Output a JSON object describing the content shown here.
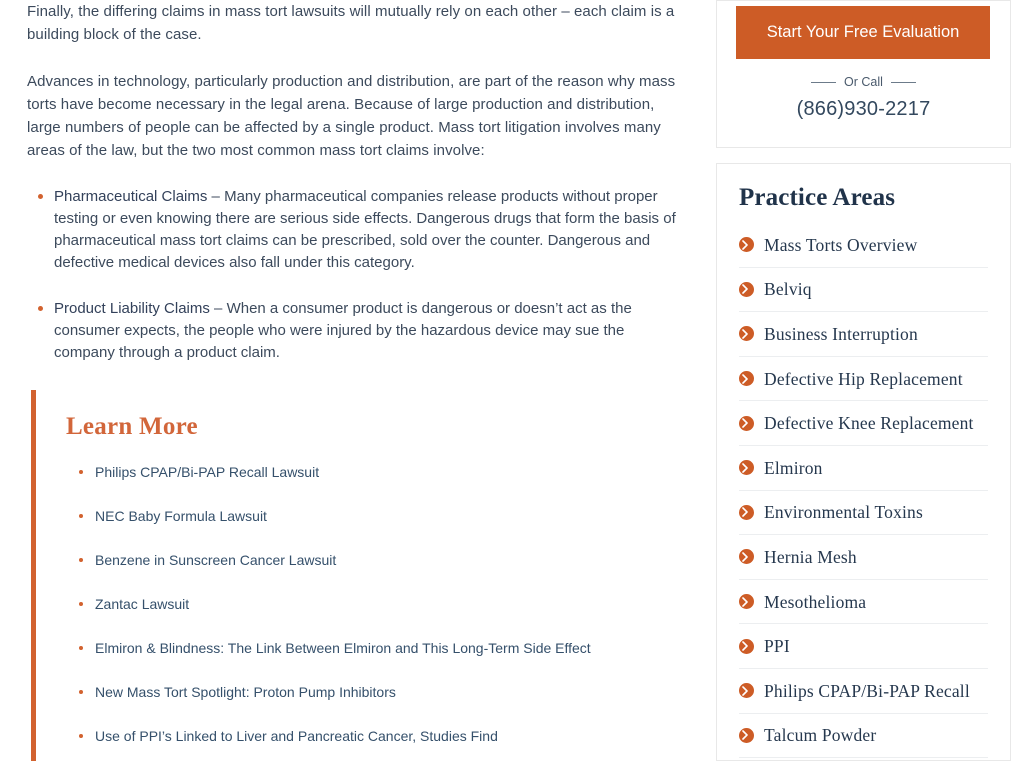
{
  "main": {
    "paragraphs": [
      "Finally, the differing claims in mass tort lawsuits will mutually rely on each other – each claim is a building block of the case.",
      "Advances in technology, particularly production and distribution, are part of the reason why mass torts have become necessary in the legal arena. Because of large production and distribution, large numbers of people can be affected by a single product. Mass tort litigation involves many areas of the law, but the two most common mass tort claims involve:"
    ],
    "claims": [
      {
        "title": "Pharmaceutical Claims",
        "body": " – Many pharmaceutical companies release products without proper testing or even knowing there are serious side effects. Dangerous drugs that form the basis of pharmaceutical mass tort claims can be prescribed, sold over the counter. Dangerous and defective medical devices also fall under this category."
      },
      {
        "title": "Product Liability Claims",
        "body": " – When a consumer product is dangerous or doesn’t act as the consumer expects, the people who were injured by the hazardous device may sue the company through a product claim."
      }
    ]
  },
  "learn_more": {
    "heading": "Learn More",
    "links": [
      "Philips CPAP/Bi-PAP Recall Lawsuit",
      "NEC Baby Formula Lawsuit",
      "Benzene in Sunscreen Cancer Lawsuit",
      "Zantac Lawsuit",
      "Elmiron & Blindness: The Link Between Elmiron and This Long-Term Side Effect",
      "New Mass Tort Spotlight: Proton Pump Inhibitors",
      "Use of PPI’s Linked to Liver and Pancreatic Cancer, Studies Find"
    ]
  },
  "sidebar": {
    "cta": {
      "button_label": "Start Your Free Evaluation",
      "or_call_label": "Or Call",
      "phone": "(866)930-2217"
    },
    "practice_areas": {
      "heading": "Practice Areas",
      "items": [
        "Mass Torts Overview",
        "Belviq",
        "Business Interruption",
        "Defective Hip Replacement",
        "Defective Knee Replacement",
        "Elmiron",
        "Environmental Toxins",
        "Hernia Mesh",
        "Mesothelioma",
        "PPI",
        "Philips CPAP/Bi-PAP Recall",
        "Talcum Powder"
      ],
      "item_icon": "chevron-right-circle-icon"
    }
  },
  "colors": {
    "accent_orange": "#cd5c26",
    "heading_orange": "#d2663a",
    "navy": "#20334a",
    "body_text": "#3c4a5c",
    "link_blue": "#35506b",
    "card_border": "#e8e8e8"
  }
}
